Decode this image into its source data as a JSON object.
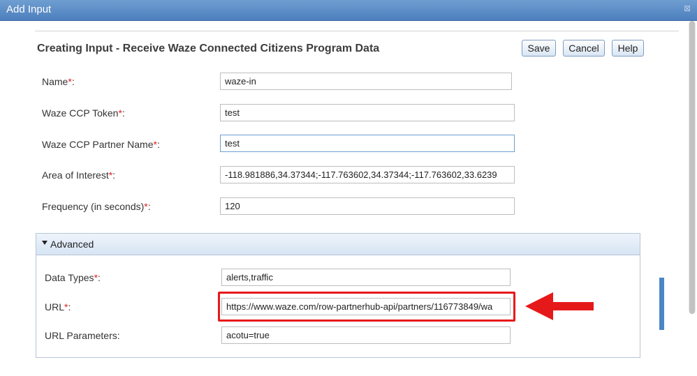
{
  "window": {
    "title": "Add Input",
    "close_glyph": "⊠"
  },
  "heading": "Creating Input - Receive Waze Connected Citizens Program Data",
  "buttons": {
    "save": "Save",
    "cancel": "Cancel",
    "help": "Help"
  },
  "required_marker": "*",
  "fields": [
    {
      "label": "Name",
      "value": "waze-in"
    },
    {
      "label": "Waze CCP Token",
      "value": "test"
    },
    {
      "label": "Waze CCP Partner Name",
      "value": "test"
    },
    {
      "label": "Area of Interest",
      "value": "-118.981886,34.37344;-117.763602,34.37344;-117.763602,33.6239"
    },
    {
      "label": "Frequency (in seconds)",
      "value": "120"
    }
  ],
  "advanced": {
    "title": "Advanced",
    "fields": [
      {
        "label": "Data Types",
        "value": "alerts,traffic"
      },
      {
        "label": "URL",
        "value": "https://www.waze.com/row-partnerhub-api/partners/116773849/wa"
      },
      {
        "label": "URL Parameters",
        "value": "acotu=true"
      }
    ]
  },
  "colors": {
    "accent": "#4c7fbd",
    "required": "#e02020",
    "highlight": "#e6191a"
  },
  "icons": {
    "close": "close-icon",
    "caret": "caret-down-icon",
    "arrow": "arrow-left-icon"
  }
}
